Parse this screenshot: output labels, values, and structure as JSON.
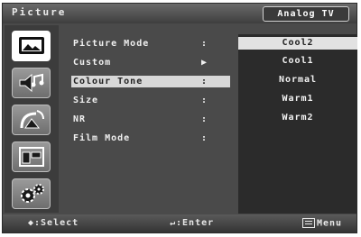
{
  "header": {
    "title": "Picture",
    "source": "Analog TV"
  },
  "sidebar": {
    "items": [
      {
        "name": "picture",
        "icon": "picture-icon",
        "active": true
      },
      {
        "name": "sound",
        "icon": "sound-icon",
        "active": false
      },
      {
        "name": "channel",
        "icon": "channel-icon",
        "active": false
      },
      {
        "name": "setup",
        "icon": "setup-icon",
        "active": false
      },
      {
        "name": "settings",
        "icon": "settings-icon",
        "active": false
      }
    ]
  },
  "menu": {
    "items": [
      {
        "label": "Picture Mode",
        "mark": ":"
      },
      {
        "label": "Custom",
        "mark": "▶"
      },
      {
        "label": "Colour Tone",
        "mark": ":"
      },
      {
        "label": "Size",
        "mark": ":"
      },
      {
        "label": "NR",
        "mark": ":"
      },
      {
        "label": "Film Mode",
        "mark": ":"
      }
    ],
    "selected_index": 2
  },
  "submenu": {
    "options": [
      "Cool2",
      "Cool1",
      "Normal",
      "Warm1",
      "Warm2"
    ],
    "selected_index": 0
  },
  "footer": {
    "select": "◆:Select",
    "enter": "↵:Enter",
    "menu": "Menu"
  },
  "colors": {
    "background": "#4a4a4a",
    "panel": "#2b2b2b",
    "highlight": "#e2e2e2",
    "text": "#f0f0f0"
  }
}
